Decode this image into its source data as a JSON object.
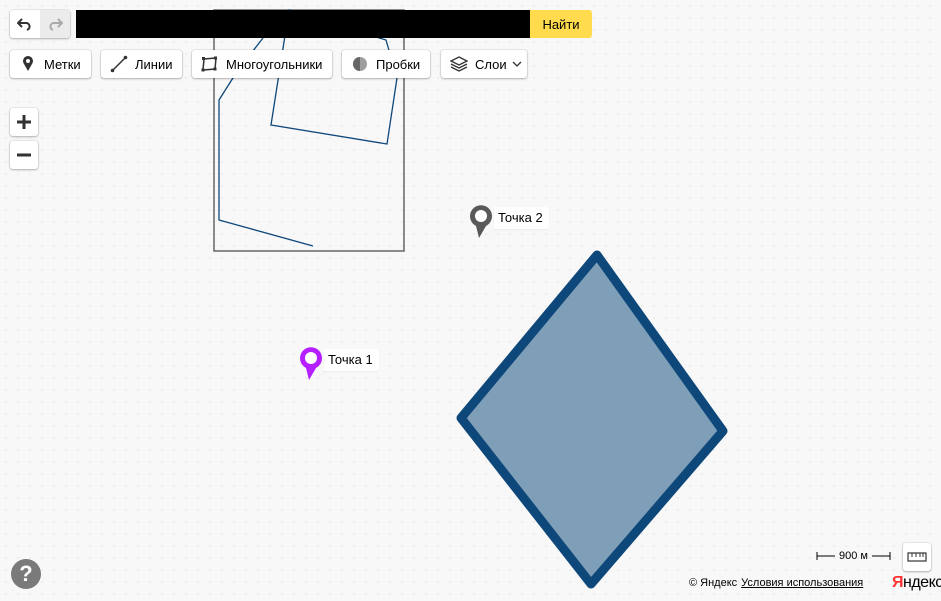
{
  "toolbar": {
    "undo_icon": "undo-arrow-icon",
    "redo_icon": "redo-arrow-icon",
    "search_value": "",
    "search_button_label": "Найти",
    "tools": [
      {
        "label": "Метки",
        "icon": "placemark-icon"
      },
      {
        "label": "Линии",
        "icon": "line-icon"
      },
      {
        "label": "Многоугольники",
        "icon": "polygon-icon"
      },
      {
        "label": "Пробки",
        "icon": "traffic-icon"
      },
      {
        "label": "Слои",
        "icon": "layers-icon"
      }
    ]
  },
  "zoom": {
    "in_icon": "plus-icon",
    "out_icon": "minus-icon"
  },
  "map": {
    "placemarks": [
      {
        "label": "Точка 1",
        "color": "#b51eff"
      },
      {
        "label": "Точка 2",
        "color": "#595959"
      }
    ],
    "polygon": {
      "fill": "#7f9fb8",
      "stroke": "#0e4779"
    }
  },
  "footer": {
    "help_label": "?",
    "scale_label": "900 м",
    "copyright": "© Яндекс",
    "terms_link": "Условия использования",
    "logo_first": "Я",
    "logo_rest": "ндекс"
  },
  "colors": {
    "accent": "#ffdb4d",
    "line": "#0e4779",
    "rect_border": "#666666"
  }
}
